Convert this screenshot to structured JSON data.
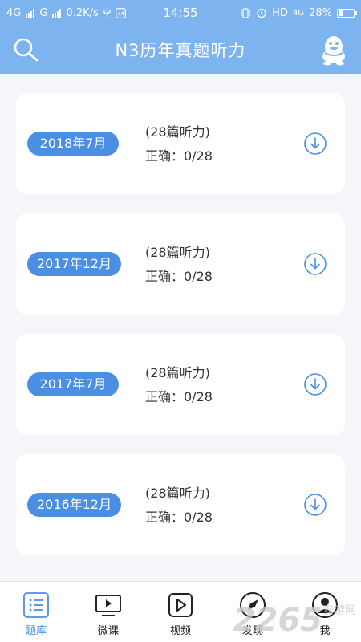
{
  "status_bar": {
    "net1": "4G",
    "net2": "G",
    "speed": "0.2K/s",
    "time": "14:55",
    "hd": "HD",
    "net3": "4G",
    "battery": "28%"
  },
  "header": {
    "title": "N3历年真题听力",
    "search_icon": "search-icon",
    "qq_icon": "qq-penguin-icon"
  },
  "papers": [
    {
      "date": "2018年7月",
      "count": "(28篇听力)",
      "score": "正确：0/28"
    },
    {
      "date": "2017年12月",
      "count": "(28篇听力)",
      "score": "正确：0/28"
    },
    {
      "date": "2017年7月",
      "count": "(28篇听力)",
      "score": "正确：0/28"
    },
    {
      "date": "2016年12月",
      "count": "(28篇听力)",
      "score": "正确：0/28"
    }
  ],
  "bottom_nav": [
    {
      "label": "题库",
      "icon": "list-icon",
      "active": true
    },
    {
      "label": "微课",
      "icon": "video-lesson-icon",
      "active": false
    },
    {
      "label": "视频",
      "icon": "play-icon",
      "active": false
    },
    {
      "label": "发现",
      "icon": "compass-icon",
      "active": false
    },
    {
      "label": "我",
      "icon": "user-icon",
      "active": false
    }
  ],
  "watermark": {
    "text": "2265",
    "sub": "安游网"
  },
  "colors": {
    "primary": "#7db3ee",
    "accent": "#4a8fe4",
    "background": "#f4f6f9"
  }
}
